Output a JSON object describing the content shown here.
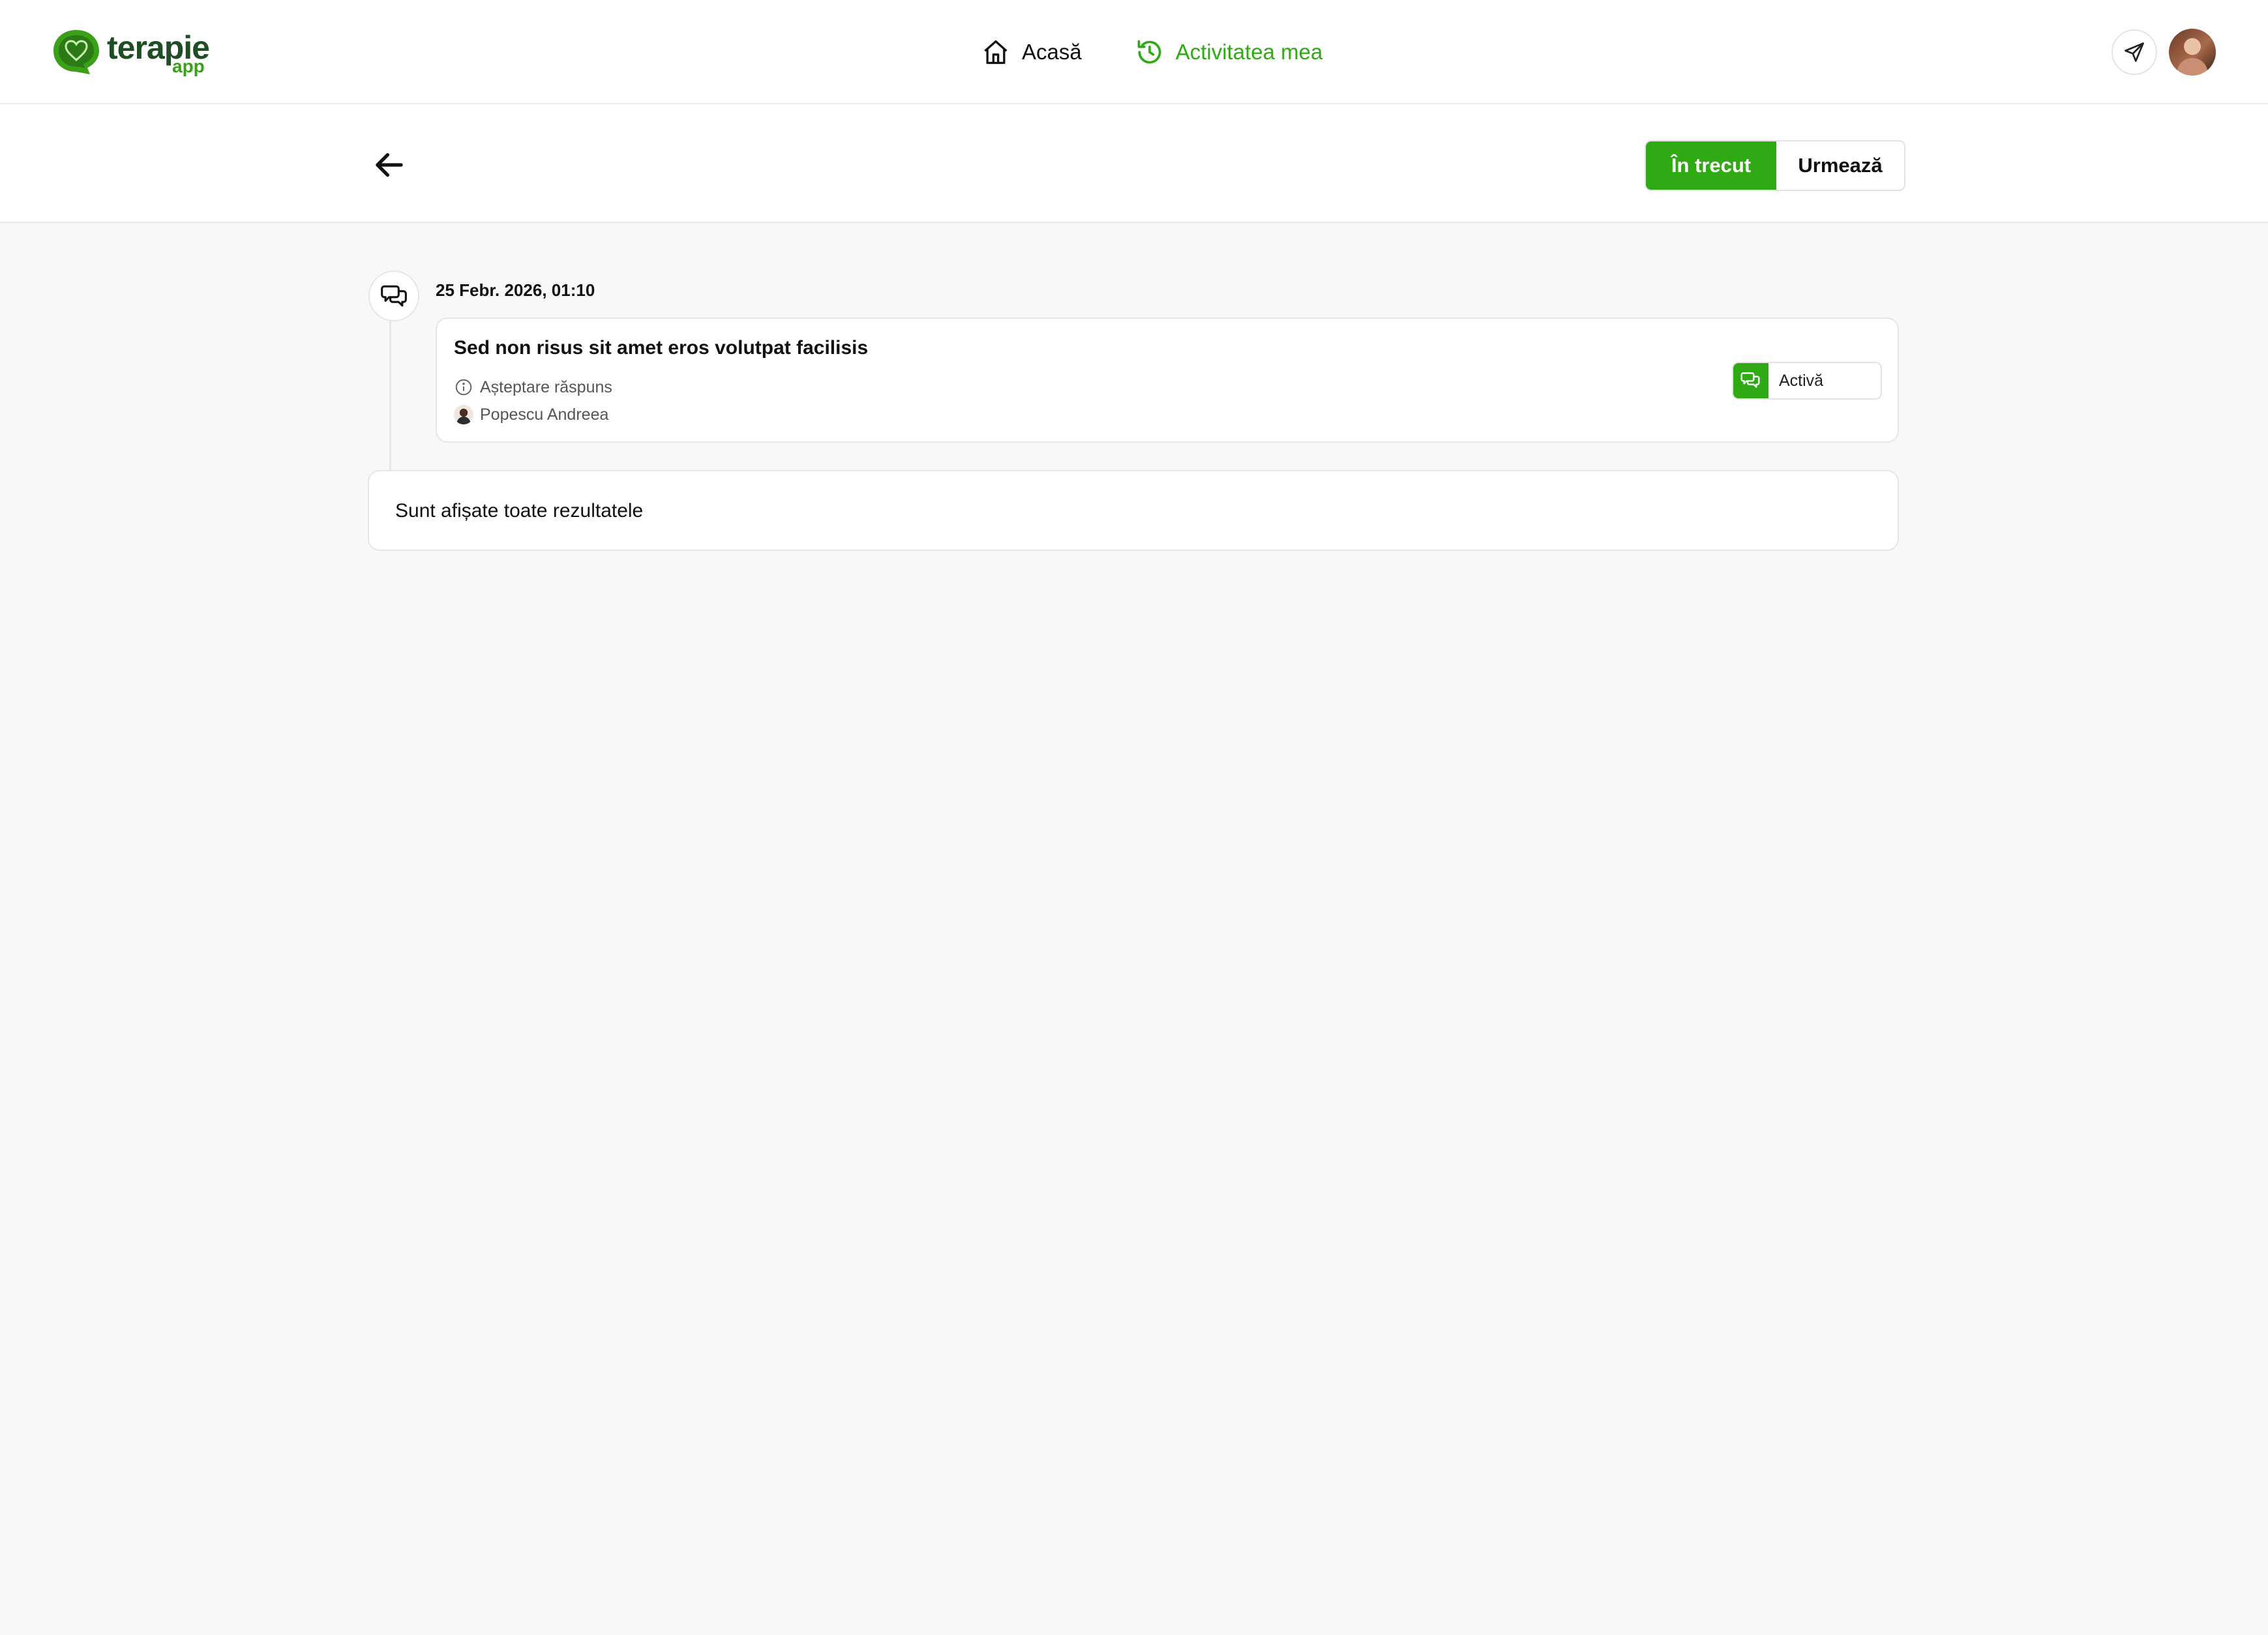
{
  "brand": {
    "name": "terapie",
    "sub": "app",
    "color": "#2faa14",
    "icons": {
      "logo": "chat-bubble-heart"
    }
  },
  "nav": {
    "items": [
      {
        "label": "Acasă",
        "icon": "home-icon",
        "active": false
      },
      {
        "label": "Activitatea mea",
        "icon": "history-icon",
        "active": true
      }
    ]
  },
  "topbar": {
    "icons": [
      "send-icon",
      "avatar"
    ]
  },
  "filters": {
    "past_label": "În trecut",
    "upcoming_label": "Urmează",
    "selected": "În trecut"
  },
  "timeline": [
    {
      "date": "25 Febr. 2026, 01:10",
      "icon": "chat-bubbles-icon",
      "title": "Sed non risus sit amet eros volutpat facilisis",
      "status_text": "Așteptare răspuns",
      "person": "Popescu Andreea",
      "badge": "Activă"
    }
  ],
  "end_message": "Sunt afișate toate rezultatele"
}
